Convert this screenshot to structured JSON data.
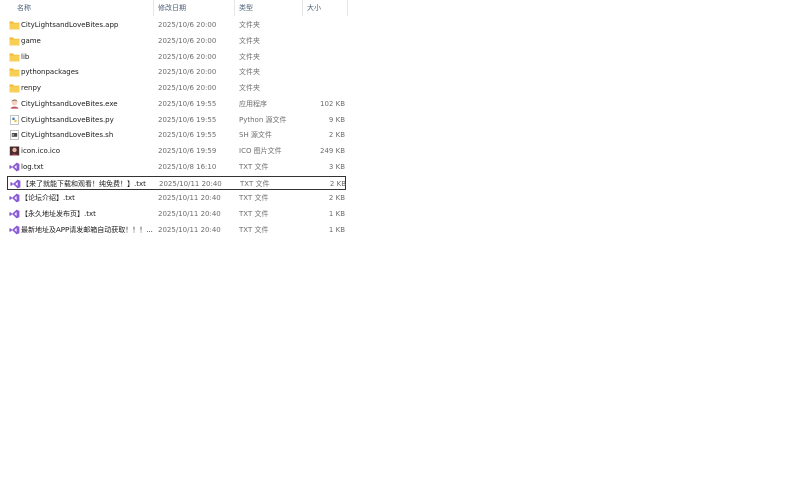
{
  "columns": {
    "name": "名称",
    "date": "修改日期",
    "type": "类型",
    "size": "大小"
  },
  "files": [
    {
      "name": "CityLightsandLoveBites.app",
      "date": "2025/10/6 20:00",
      "type": "文件夹",
      "size": "",
      "icon": "folder-icon"
    },
    {
      "name": "game",
      "date": "2025/10/6 20:00",
      "type": "文件夹",
      "size": "",
      "icon": "folder-icon"
    },
    {
      "name": "lib",
      "date": "2025/10/6 20:00",
      "type": "文件夹",
      "size": "",
      "icon": "folder-icon"
    },
    {
      "name": "pythonpackages",
      "date": "2025/10/6 20:00",
      "type": "文件夹",
      "size": "",
      "icon": "folder-icon"
    },
    {
      "name": "renpy",
      "date": "2025/10/6 20:00",
      "type": "文件夹",
      "size": "",
      "icon": "folder-icon"
    },
    {
      "name": "CityLightsandLoveBites.exe",
      "date": "2025/10/6 19:55",
      "type": "应用程序",
      "size": "102 KB",
      "icon": "app-exe-icon"
    },
    {
      "name": "CityLightsandLoveBites.py",
      "date": "2025/10/6 19:55",
      "type": "Python 源文件",
      "size": "9 KB",
      "icon": "python-file-icon"
    },
    {
      "name": "CityLightsandLoveBites.sh",
      "date": "2025/10/6 19:55",
      "type": "SH 源文件",
      "size": "2 KB",
      "icon": "shell-script-icon"
    },
    {
      "name": "icon.ico.ico",
      "date": "2025/10/6 19:59",
      "type": "ICO 图片文件",
      "size": "249 KB",
      "icon": "image-file-icon"
    },
    {
      "name": "log.txt",
      "date": "2025/10/8 16:10",
      "type": "TXT 文件",
      "size": "3 KB",
      "icon": "vs-text-file-icon"
    },
    {
      "name": "【来了就能下载和观看！纯免费！】.txt",
      "date": "2025/10/11 20:40",
      "type": "TXT 文件",
      "size": "2 KB",
      "icon": "vs-text-file-icon",
      "selected": true
    },
    {
      "name": "【论坛介绍】.txt",
      "date": "2025/10/11 20:40",
      "type": "TXT 文件",
      "size": "2 KB",
      "icon": "vs-text-file-icon"
    },
    {
      "name": "【永久地址发布页】.txt",
      "date": "2025/10/11 20:40",
      "type": "TXT 文件",
      "size": "1 KB",
      "icon": "vs-text-file-icon"
    },
    {
      "name": "最新地址及APP请发邮箱自动获取！！！...",
      "date": "2025/10/11 20:40",
      "type": "TXT 文件",
      "size": "1 KB",
      "icon": "vs-text-file-icon"
    }
  ],
  "colors": {
    "folder": "#f6c443",
    "vs_purple": "#8a5cd6",
    "selection_border": "#333333"
  }
}
